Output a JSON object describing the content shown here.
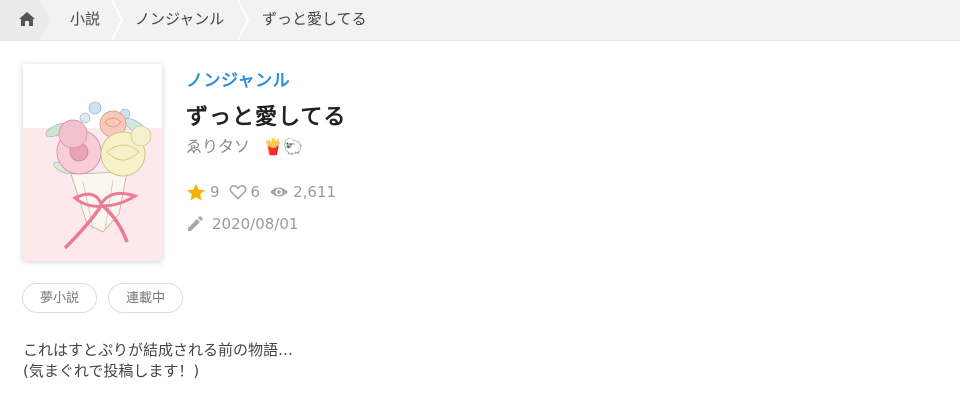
{
  "breadcrumb": {
    "items": [
      "小説",
      "ノンジャンル",
      "ずっと愛してる"
    ]
  },
  "novel": {
    "genre": "ノンジャンル",
    "title": "ずっと愛してる",
    "author": "ゑりタソ",
    "author_emojis": "🍟🐑",
    "stars": "9",
    "likes": "6",
    "views": "2,611",
    "date": "2020/08/01",
    "tags": [
      "夢小説",
      "連載中"
    ],
    "description_lines": [
      "これはすとぷりが結成される前の物語…",
      "(気まぐれで投稿します！)"
    ]
  },
  "colors": {
    "accent": "#2b8fd6",
    "star": "#f5b301",
    "ribbon": "#ec7b98"
  }
}
